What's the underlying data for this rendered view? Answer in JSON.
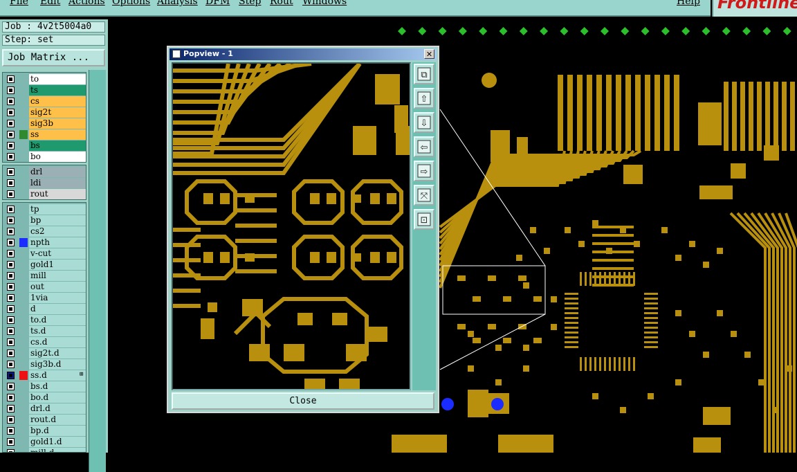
{
  "menubar": {
    "items": [
      "File",
      "Edit",
      "Actions",
      "Options",
      "Analysis",
      "DFM",
      "Step",
      "Rout",
      "Windows"
    ],
    "help": "Help",
    "logo": "Frontline"
  },
  "job": {
    "label": "Job : 4v2t5004a0",
    "step": "Step: set",
    "matrix_button": "Job Matrix ..."
  },
  "layers": {
    "group1": [
      {
        "name": "to",
        "color": "#ffffff",
        "swatch": ""
      },
      {
        "name": "ts",
        "color": "#1e9a6e",
        "swatch": ""
      },
      {
        "name": "cs",
        "color": "#ffc04a",
        "swatch": ""
      },
      {
        "name": "sig2t",
        "color": "#ffc04a",
        "swatch": ""
      },
      {
        "name": "sig3b",
        "color": "#ffc04a",
        "swatch": ""
      },
      {
        "name": "ss",
        "color": "#ffc04a",
        "swatch": "#2f8a2f"
      },
      {
        "name": "bs",
        "color": "#1e9a6e",
        "swatch": ""
      },
      {
        "name": "bo",
        "color": "#ffffff",
        "swatch": ""
      }
    ],
    "group2": [
      {
        "name": "drl",
        "color": "#9ab0b4",
        "swatch": ""
      },
      {
        "name": "ldi",
        "color": "#9ab0b4",
        "swatch": ""
      },
      {
        "name": "rout",
        "color": "#d8d8d8",
        "swatch": ""
      }
    ],
    "group3": [
      {
        "name": "tp",
        "color": "#a8dcd4",
        "swatch": ""
      },
      {
        "name": "bp",
        "color": "#a8dcd4",
        "swatch": ""
      },
      {
        "name": "cs2",
        "color": "#a8dcd4",
        "swatch": ""
      },
      {
        "name": "npth",
        "color": "#a8dcd4",
        "swatch": "#1a2cff"
      },
      {
        "name": "v-cut",
        "color": "#a8dcd4",
        "swatch": ""
      },
      {
        "name": "gold1",
        "color": "#a8dcd4",
        "swatch": ""
      },
      {
        "name": "mill",
        "color": "#a8dcd4",
        "swatch": ""
      },
      {
        "name": "out",
        "color": "#a8dcd4",
        "swatch": ""
      },
      {
        "name": "1via",
        "color": "#a8dcd4",
        "swatch": ""
      },
      {
        "name": "d",
        "color": "#a8dcd4",
        "swatch": ""
      },
      {
        "name": "to.d",
        "color": "#a8dcd4",
        "swatch": ""
      },
      {
        "name": "ts.d",
        "color": "#a8dcd4",
        "swatch": ""
      },
      {
        "name": "cs.d",
        "color": "#a8dcd4",
        "swatch": ""
      },
      {
        "name": "sig2t.d",
        "color": "#a8dcd4",
        "swatch": ""
      },
      {
        "name": "sig3b.d",
        "color": "#a8dcd4",
        "swatch": ""
      },
      {
        "name": "ss.d",
        "color": "#a8dcd4",
        "swatch": "#ee1111",
        "selected": true,
        "mark": "⊞"
      },
      {
        "name": "bs.d",
        "color": "#a8dcd4",
        "swatch": ""
      },
      {
        "name": "bo.d",
        "color": "#a8dcd4",
        "swatch": ""
      },
      {
        "name": "drl.d",
        "color": "#a8dcd4",
        "swatch": ""
      },
      {
        "name": "rout.d",
        "color": "#a8dcd4",
        "swatch": ""
      },
      {
        "name": "bp.d",
        "color": "#a8dcd4",
        "swatch": ""
      },
      {
        "name": "gold1.d",
        "color": "#a8dcd4",
        "swatch": ""
      },
      {
        "name": "mill.d",
        "color": "#a8dcd4",
        "swatch": ""
      }
    ]
  },
  "popview": {
    "title": "Popview - 1",
    "close_x": "✕",
    "close_button": "Close",
    "tools": [
      "zoom-window-icon",
      "pan-up-icon",
      "pan-down-icon",
      "pan-left-icon",
      "pan-right-icon",
      "zoom-fit-icon",
      "zoom-home-icon"
    ]
  },
  "colors": {
    "copper": "#b8900e",
    "board": "#000000",
    "panel": "#9fd3c8",
    "via_blue": "#1a2cff"
  }
}
